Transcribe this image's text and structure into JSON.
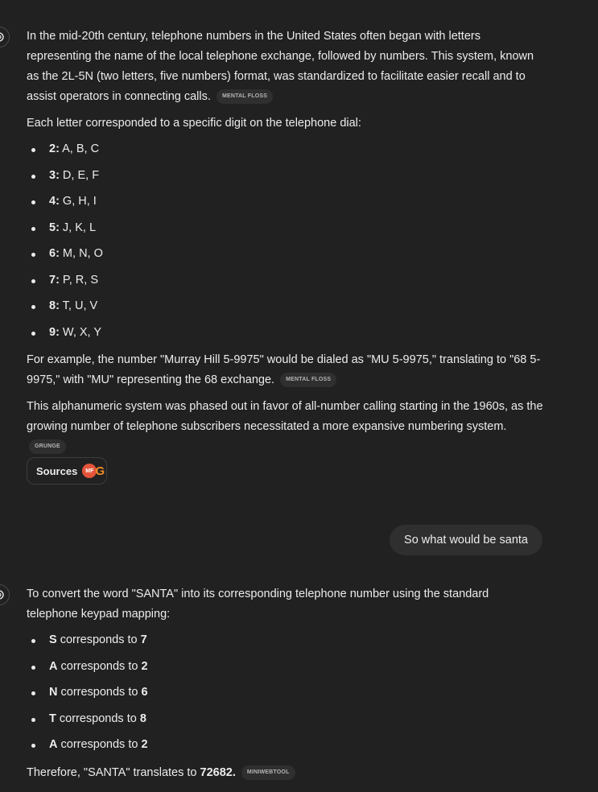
{
  "msg1": {
    "p1": "In the mid-20th century, telephone numbers in the United States often began with letters representing the name of the local telephone exchange, followed by numbers. This system, known as the 2L-5N (two letters, five numbers) format, was standardized to facilitate easier recall and to assist operators in connecting calls.",
    "p1_source": "MENTAL FLOSS",
    "p2": "Each letter corresponded to a specific digit on the telephone dial:",
    "dial": [
      {
        "digit": "2:",
        "letters": " A, B, C"
      },
      {
        "digit": "3:",
        "letters": " D, E, F"
      },
      {
        "digit": "4:",
        "letters": " G, H, I"
      },
      {
        "digit": "5:",
        "letters": " J, K, L"
      },
      {
        "digit": "6:",
        "letters": " M, N, O"
      },
      {
        "digit": "7:",
        "letters": " P, R, S"
      },
      {
        "digit": "8:",
        "letters": " T, U, V"
      },
      {
        "digit": "9:",
        "letters": " W, X, Y"
      }
    ],
    "p3": "For example, the number \"Murray Hill 5-9975\" would be dialed as \"MU 5-9975,\" translating to \"68 5-9975,\" with \"MU\" representing the 68 exchange.",
    "p3_source": "MENTAL FLOSS",
    "p4": "This alphanumeric system was phased out in favor of all-number calling starting in the 1960s, as the growing number of telephone subscribers necessitated a more expansive numbering system.",
    "p4_source": "GRUNGE",
    "sources_label": "Sources",
    "source_icon_mf": "MF",
    "source_icon_g": "G"
  },
  "user_msg": "So what would be santa",
  "msg2": {
    "p1": "To convert the word \"SANTA\" into its corresponding telephone number using the standard telephone keypad mapping:",
    "mapping": [
      {
        "letter": "S",
        "mid": " corresponds to ",
        "digit": "7"
      },
      {
        "letter": "A",
        "mid": " corresponds to ",
        "digit": "2"
      },
      {
        "letter": "N",
        "mid": " corresponds to ",
        "digit": "6"
      },
      {
        "letter": "T",
        "mid": " corresponds to ",
        "digit": "8"
      },
      {
        "letter": "A",
        "mid": " corresponds to ",
        "digit": "2"
      }
    ],
    "conclusion_pre": "Therefore, \"SANTA\" translates to ",
    "conclusion_value": "72682.",
    "conclusion_source": "MINIWEBTOOL"
  }
}
